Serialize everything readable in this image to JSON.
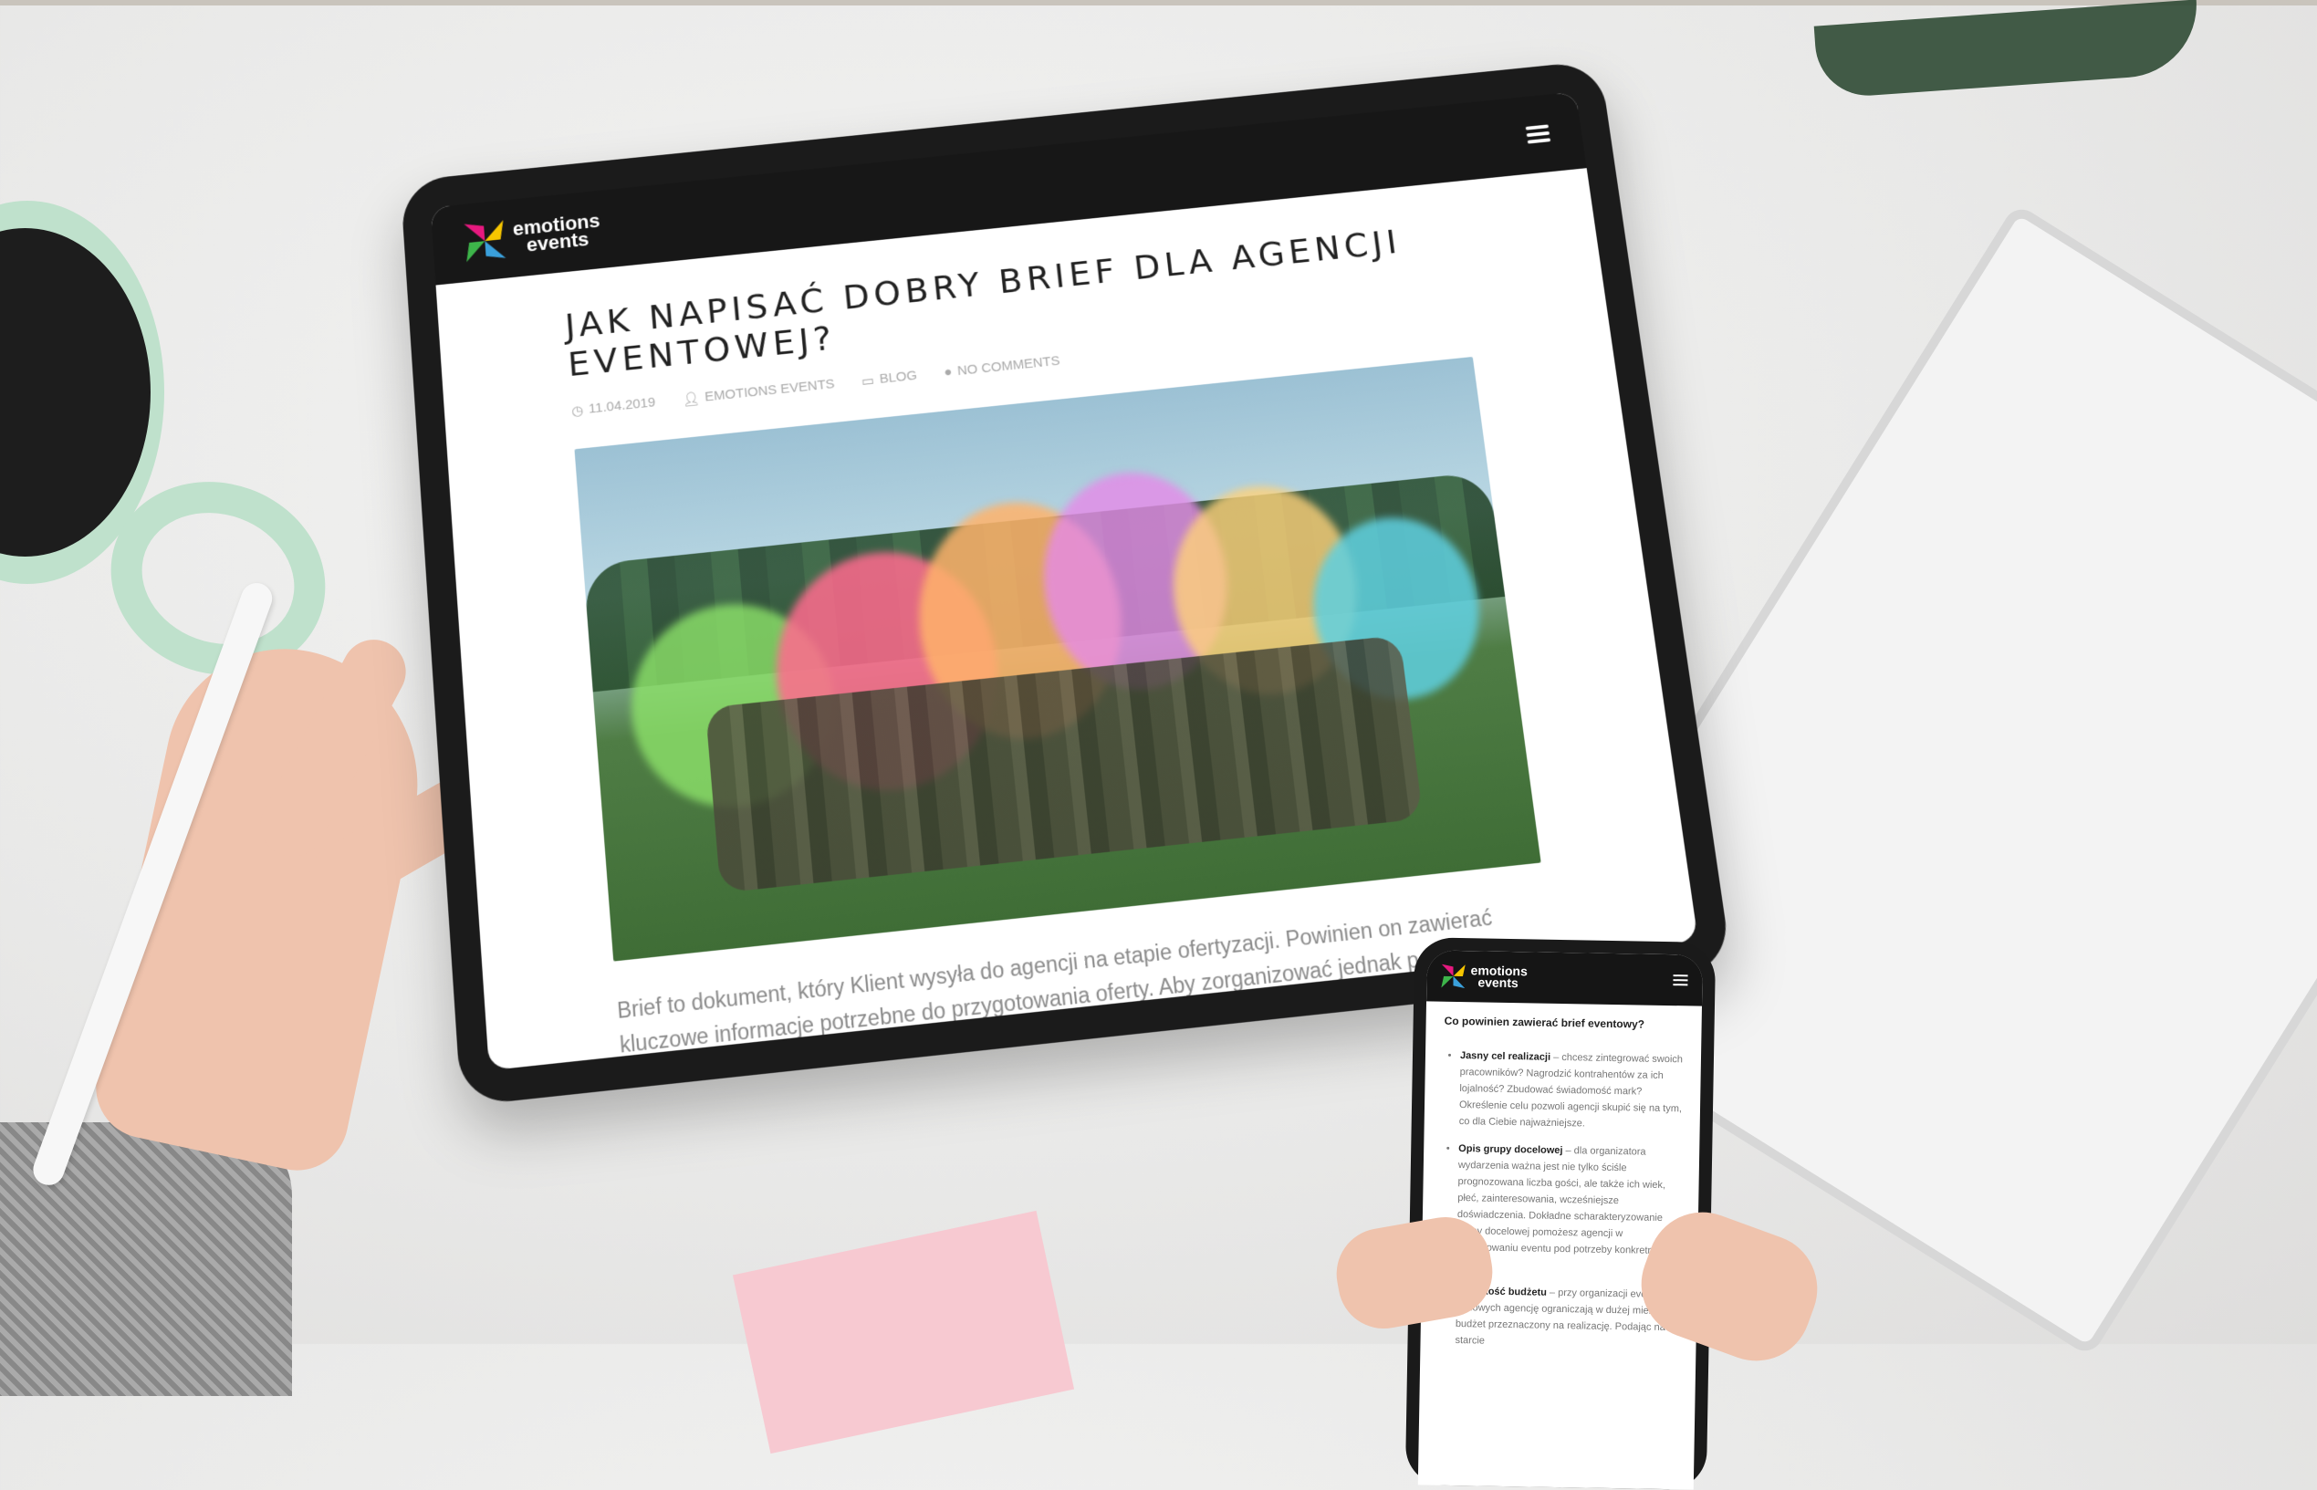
{
  "tablet": {
    "logo": {
      "line1": "emotions",
      "line2": "events"
    },
    "post": {
      "title": "JAK NAPISAĆ DOBRY BRIEF DLA AGENCJI EVENTOWEJ?",
      "meta": {
        "date": "11.04.2019",
        "author": "EMOTIONS EVENTS",
        "category": "BLOG",
        "comments": "NO COMMENTS"
      },
      "excerpt": "Brief to dokument, który Klient wysyła do agencji na etapie ofertyzacji. Powinien on zawierać kluczowe informacje potrzebne do przygotowania oferty. Aby zorganizować jednak perfekcyjny event, sam formularz to za mało. Kluczowe"
    }
  },
  "phone": {
    "logo": {
      "line1": "emotions",
      "line2": "events"
    },
    "heading": "Co powinien zawierać brief eventowy?",
    "items": [
      {
        "title": "Jasny cel realizacji",
        "text": " – chcesz zintegrować swoich pracowników? Nagrodzić kontrahentów za ich lojalność? Zbudować świadomość mark? Określenie celu pozwoli agencji skupić się na tym, co dla Ciebie najważniejsze."
      },
      {
        "title": "Opis grupy docelowej",
        "text": " – dla organizatora wydarzenia ważna jest nie tylko ściśle prognozowana liczba gości, ale także ich wiek, płeć, zainteresowania, wcześniejsze doświadczenia. Dokładne scharakteryzowanie grupy docelowej pomożesz agencji w zaplanowaniu eventu pod potrzeby konkretnej grupy."
      },
      {
        "title": "Wysokość budżetu",
        "text": " – przy organizacji eventów firmowych agencję ograniczają w dużej mierze budżet przeznaczony na realizację. Podając na starcie"
      }
    ]
  },
  "colors": {
    "header_bg": "#171717",
    "logo_pink": "#e6197f",
    "logo_yellow": "#f7c600",
    "logo_blue": "#3aa0db",
    "logo_green": "#3db54a"
  }
}
